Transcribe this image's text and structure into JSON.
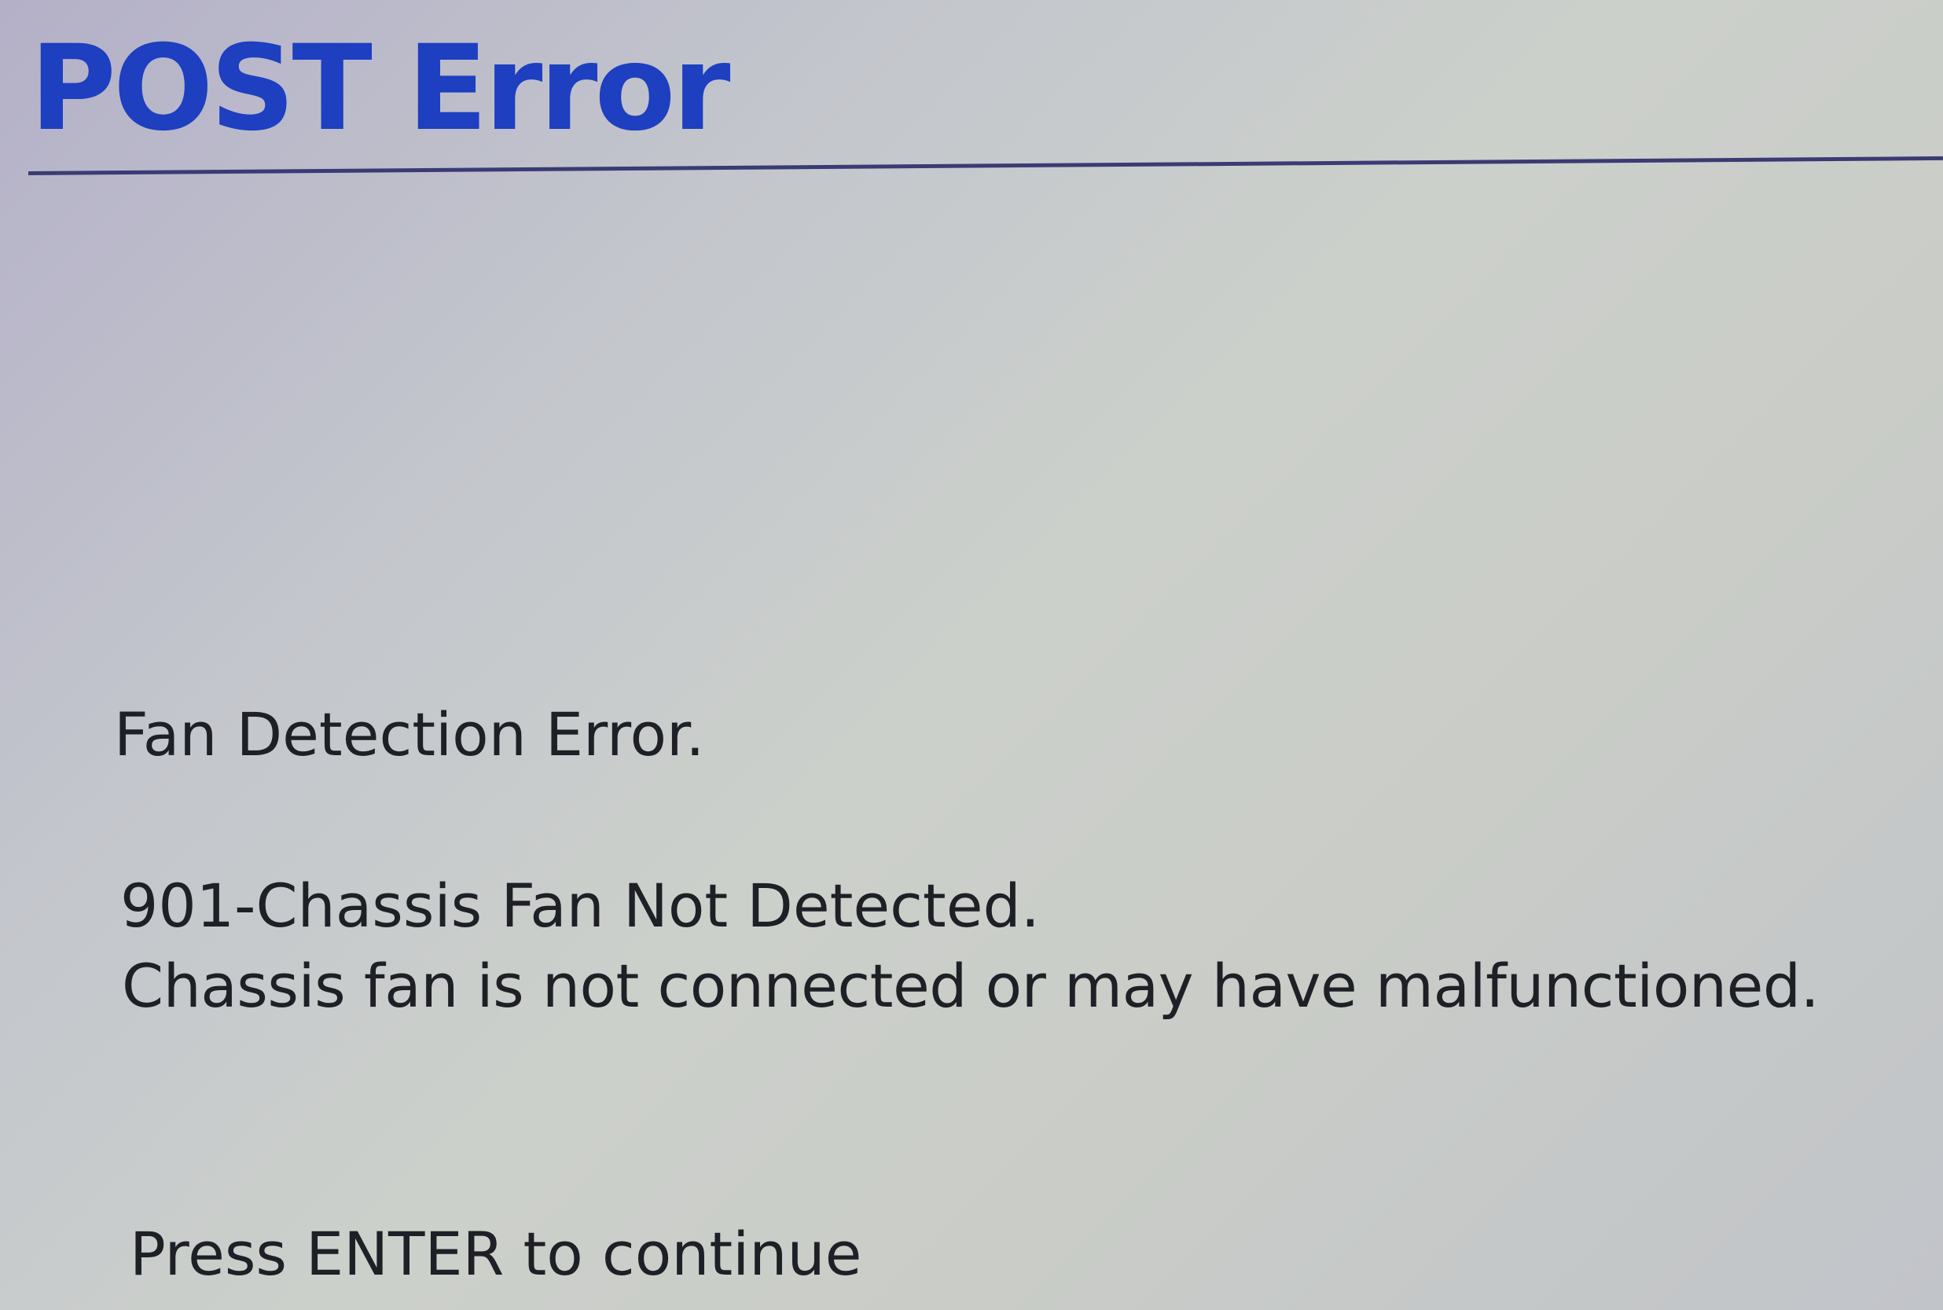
{
  "screen": {
    "title": "POST Error",
    "error_heading": "Fan Detection Error.",
    "error_code_line": "901-Chassis Fan Not Detected.",
    "error_description": "Chassis fan is not connected or may have malfunctioned.",
    "prompt": "Press ENTER to continue"
  },
  "colors": {
    "title": "#1d3fc0",
    "text": "#1e2026",
    "rule": "#3a3b74",
    "background": "#c8cbc8"
  }
}
